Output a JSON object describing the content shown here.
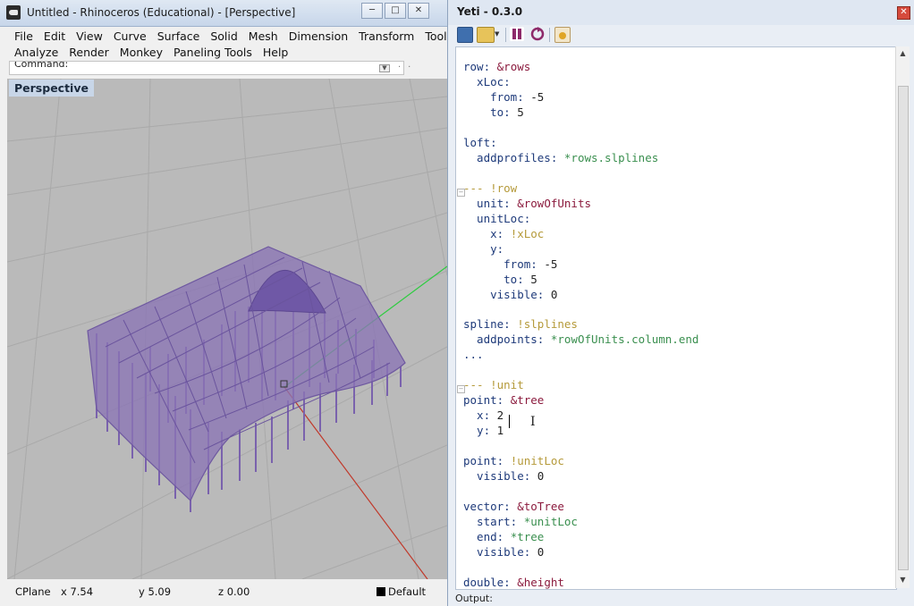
{
  "rhino": {
    "title": "Untitled - Rhinoceros (Educational) - [Perspective]",
    "menu_row1": [
      "File",
      "Edit",
      "View",
      "Curve",
      "Surface",
      "Solid",
      "Mesh",
      "Dimension",
      "Transform",
      "Tools"
    ],
    "menu_row2": [
      "Analyze",
      "Render",
      "Monkey",
      "Paneling Tools",
      "Help"
    ],
    "command_label": "Command:",
    "viewport_label": "Perspective",
    "status": {
      "cplane": "CPlane",
      "x": "x 7.54",
      "y": "y 5.09",
      "z": "z 0.00",
      "layer": "Default"
    },
    "colors": {
      "surface": "#8a74b5",
      "x_axis": "#c0392b",
      "y_axis": "#2ecc40",
      "viewport_bg": "#b9b9b9"
    }
  },
  "yeti": {
    "title": "Yeti - 0.3.0",
    "output_label": "Output:",
    "toolbar_icons": [
      "save-icon",
      "open-folder-icon",
      "pause-icon",
      "refresh-icon",
      "screenshot-icon"
    ],
    "code_lines": [
      [
        [
          "row: ",
          "k"
        ],
        [
          "&rows",
          "anc"
        ]
      ],
      [
        [
          "  xLoc:",
          "k"
        ]
      ],
      [
        [
          "    from: ",
          "k"
        ],
        [
          "-5",
          "n"
        ]
      ],
      [
        [
          "    to: ",
          "k"
        ],
        [
          "5",
          "n"
        ]
      ],
      [],
      [
        [
          "loft:",
          "k"
        ]
      ],
      [
        [
          "  addprofiles: ",
          "k"
        ],
        [
          "*rows.slplines",
          "ref"
        ]
      ],
      [],
      [
        [
          "--- !row",
          "tag"
        ]
      ],
      [
        [
          "  unit: ",
          "k"
        ],
        [
          "&rowOfUnits",
          "anc"
        ]
      ],
      [
        [
          "  unitLoc:",
          "k"
        ]
      ],
      [
        [
          "    x: ",
          "k"
        ],
        [
          "!xLoc",
          "tag"
        ]
      ],
      [
        [
          "    y:",
          "k"
        ]
      ],
      [
        [
          "      from: ",
          "k"
        ],
        [
          "-5",
          "n"
        ]
      ],
      [
        [
          "      to: ",
          "k"
        ],
        [
          "5",
          "n"
        ]
      ],
      [
        [
          "    visible: ",
          "k"
        ],
        [
          "0",
          "n"
        ]
      ],
      [],
      [
        [
          "spline: ",
          "k"
        ],
        [
          "!slplines",
          "tag"
        ]
      ],
      [
        [
          "  addpoints: ",
          "k"
        ],
        [
          "*rowOfUnits.column.end",
          "ref"
        ]
      ],
      [
        [
          "...",
          "k"
        ]
      ],
      [],
      [
        [
          "--- !unit",
          "tag"
        ]
      ],
      [
        [
          "point: ",
          "k"
        ],
        [
          "&tree",
          "anc"
        ]
      ],
      [
        [
          "  x: ",
          "k"
        ],
        [
          "2",
          "n"
        ]
      ],
      [
        [
          "  y: ",
          "k"
        ],
        [
          "1",
          "n"
        ]
      ],
      [],
      [
        [
          "point: ",
          "k"
        ],
        [
          "!unitLoc",
          "tag"
        ]
      ],
      [
        [
          "  visible: ",
          "k"
        ],
        [
          "0",
          "n"
        ]
      ],
      [],
      [
        [
          "vector: ",
          "k"
        ],
        [
          "&toTree",
          "anc"
        ]
      ],
      [
        [
          "  start: ",
          "k"
        ],
        [
          "*unitLoc",
          "ref"
        ]
      ],
      [
        [
          "  end: ",
          "k"
        ],
        [
          "*tree",
          "ref"
        ]
      ],
      [
        [
          "  visible: ",
          "k"
        ],
        [
          "0",
          "n"
        ]
      ],
      [],
      [
        [
          "double: ",
          "k"
        ],
        [
          "&height",
          "anc"
        ]
      ]
    ]
  }
}
